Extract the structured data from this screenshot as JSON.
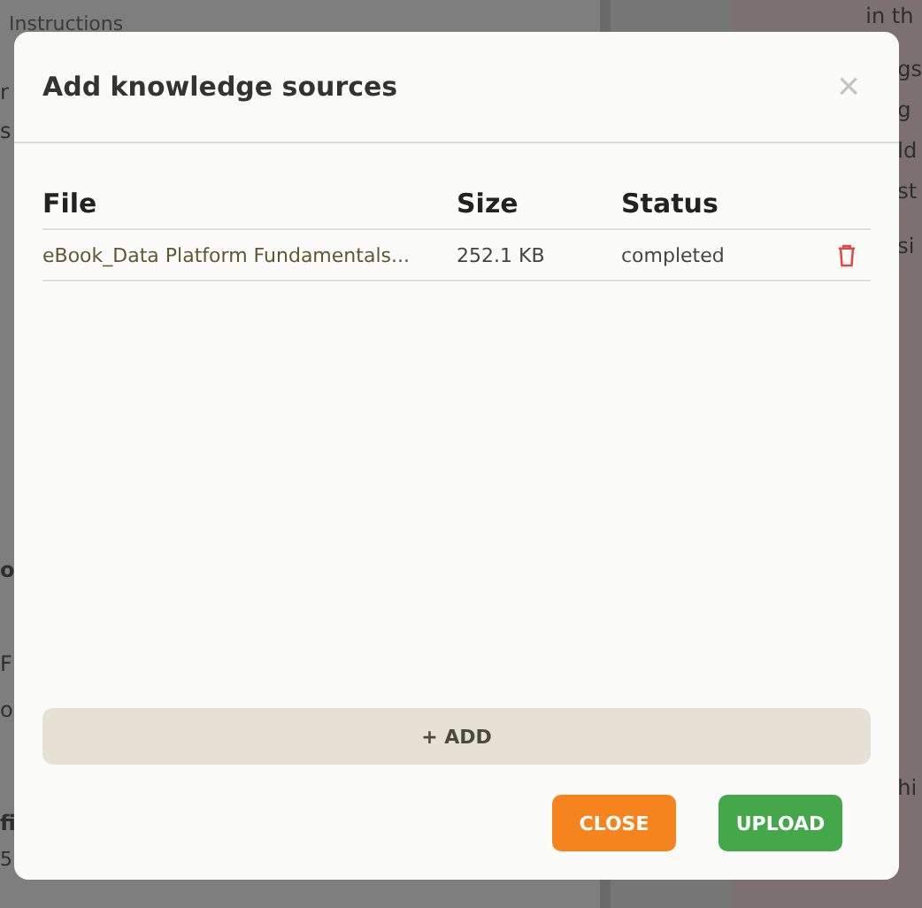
{
  "background": {
    "left_texts": [
      "Instructions",
      "r",
      "s",
      "o",
      "F",
      "o",
      "fi",
      "5"
    ],
    "right_texts": [
      "in th",
      "gs",
      "g",
      "ld",
      "st",
      "si",
      "hi"
    ]
  },
  "dialog": {
    "title": "Add knowledge sources",
    "close_icon": "×",
    "table": {
      "columns": [
        "File",
        "Size",
        "Status"
      ],
      "rows": [
        {
          "file": "eBook_Data Platform Fundamentals...",
          "size": "252.1 KB",
          "status": "completed"
        }
      ]
    },
    "add_button": "+ ADD",
    "buttons": [
      {
        "label": "CLOSE",
        "kind": "close"
      },
      {
        "label": "UPLOAD",
        "kind": "upload"
      }
    ]
  }
}
